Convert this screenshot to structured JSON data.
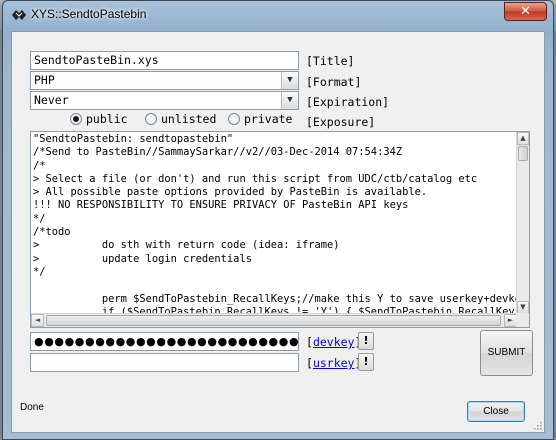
{
  "window": {
    "title": "XYS::SendtoPastebin",
    "close_glyph": "✕"
  },
  "form": {
    "title_value": "SendtoPasteBin.xys",
    "title_label": "[Title]",
    "format_value": "PHP",
    "format_label": "[Format]",
    "expiration_value": "Never",
    "expiration_label": "[Expiration]",
    "exposure_label": "[Exposure]",
    "exposure_options": [
      "public",
      "unlisted",
      "private"
    ],
    "exposure_selected": "public"
  },
  "editor": {
    "lines": [
      "\"SendtoPastebin: sendtopastebin\"",
      "/*Send to PasteBin//SammaySarkar//v2//03-Dec-2014 07:54:34Z",
      "/*",
      "> Select a file (or don't) and run this script from UDC/ctb/catalog etc",
      "> All possible paste options provided by PasteBin is available.",
      "!!! NO RESPONSIBILITY TO ENSURE PRIVACY OF PasteBin API keys",
      "*/",
      "/*todo",
      ">          do sth with return code (idea: iframe)",
      ">          update login credentials",
      "*/",
      "",
      "           perm $SendToPastebin_RecallKeys;//make this Y to save userkey+devkey a",
      "           if ($SendToPastebin_RecallKeys != 'Y') { $SendToPastebin_RecallKeys"
    ]
  },
  "credentials": {
    "devkey_mask": "●●●●●●●●●●●●●●●●●●●●●●●●●●●●●●●●",
    "devkey_label": "devkey",
    "usrkey_mask": "",
    "usrkey_label": "usrkey",
    "bang": "!"
  },
  "actions": {
    "submit_label": "SUBMIT",
    "close_label": "Close"
  },
  "status": {
    "text": "Done"
  }
}
